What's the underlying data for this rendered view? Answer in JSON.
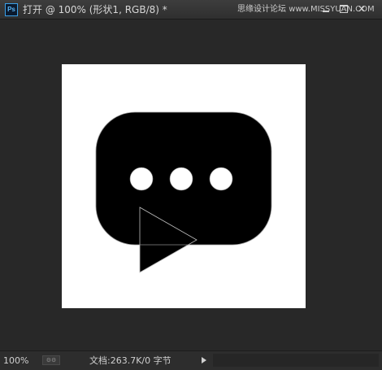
{
  "app": {
    "icon_label": "Ps",
    "document_title": "打开 @ 100% (形状1, RGB/8) *",
    "watermark": {
      "cn": "思缘设计论坛",
      "site": "www.MISSYUAN.COM"
    },
    "window_buttons": {
      "close": "✕"
    }
  },
  "canvas": {
    "background": "#ffffff",
    "shape_fill": "#000000",
    "dots_fill": "#ffffff",
    "icon": "chat-bubble-with-dots-and-play-triangle"
  },
  "status": {
    "zoom": "100%",
    "doc_info": "文档:263.7K/0 字节"
  },
  "colors": {
    "workspace": "#282828",
    "titlebar": "#353535",
    "text": "#d6d6d6"
  }
}
